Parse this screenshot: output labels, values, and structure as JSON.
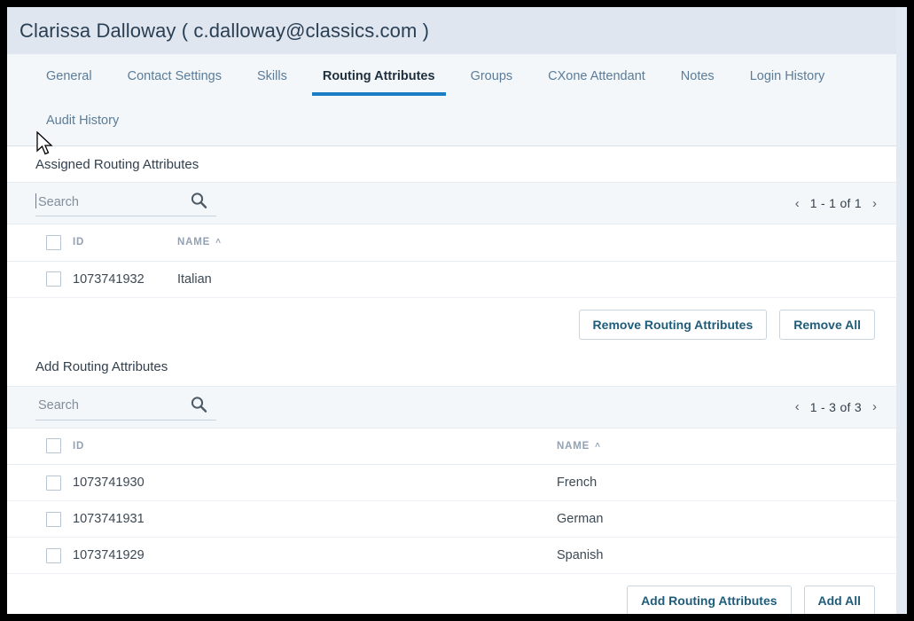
{
  "header": {
    "title": "Clarissa Dalloway ( c.dalloway@classics.com )"
  },
  "tabs": {
    "row1": [
      {
        "label": "General",
        "active": false
      },
      {
        "label": "Contact Settings",
        "active": false
      },
      {
        "label": "Skills",
        "active": false
      },
      {
        "label": "Routing Attributes",
        "active": true
      },
      {
        "label": "Groups",
        "active": false
      },
      {
        "label": "CXone Attendant",
        "active": false
      },
      {
        "label": "Notes",
        "active": false
      },
      {
        "label": "Login History",
        "active": false
      }
    ],
    "row2": [
      {
        "label": "Audit History",
        "active": false
      }
    ]
  },
  "assigned": {
    "section_title": "Assigned Routing Attributes",
    "search": {
      "placeholder": "Search",
      "value": ""
    },
    "search_icon": "search-icon",
    "pagination": {
      "prev_icon": "‹",
      "label": "1 - 1 of 1",
      "next_icon": "›"
    },
    "columns": [
      {
        "label": "ID",
        "sort": ""
      },
      {
        "label": "NAME",
        "sort": "˄"
      }
    ],
    "rows": [
      {
        "id": "1073741932",
        "name": "Italian"
      }
    ],
    "buttons": [
      {
        "label": "Remove Routing Attributes"
      },
      {
        "label": "Remove All"
      }
    ]
  },
  "add": {
    "section_title": "Add Routing Attributes",
    "search": {
      "placeholder": "Search",
      "value": ""
    },
    "search_icon": "search-icon",
    "pagination": {
      "prev_icon": "‹",
      "label": "1 - 3 of 3",
      "next_icon": "›"
    },
    "columns": [
      {
        "label": "ID",
        "sort": ""
      },
      {
        "label": "NAME",
        "sort": "˄"
      }
    ],
    "rows": [
      {
        "id": "1073741930",
        "name": "French"
      },
      {
        "id": "1073741931",
        "name": "German"
      },
      {
        "id": "1073741929",
        "name": "Spanish"
      }
    ],
    "buttons": [
      {
        "label": "Add Routing Attributes"
      },
      {
        "label": "Add All"
      }
    ]
  },
  "colors": {
    "accent": "#1b7ec4",
    "header_bg": "#dfe6ef",
    "tabs_bg": "#f3f7fa",
    "toolbar_bg": "#f3f7fa",
    "button_text": "#1f5c7a",
    "tab_text": "#5b7c99"
  }
}
